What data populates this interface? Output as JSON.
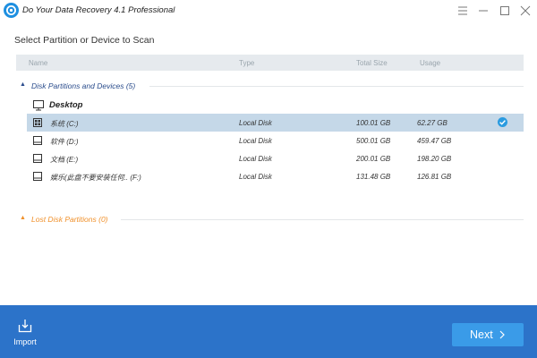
{
  "window": {
    "title": "Do Your Data Recovery 4.1 Professional",
    "controls": [
      "menu-icon",
      "minimize-icon",
      "maximize-icon",
      "close-icon"
    ]
  },
  "heading": "Select Partition or Device to Scan",
  "columns": {
    "name": "Name",
    "type": "Type",
    "total_size": "Total Size",
    "usage": "Usage"
  },
  "groups": {
    "disk": {
      "label": "Disk Partitions and Devices (5)",
      "color": "#2a4c8c",
      "expanded": true
    },
    "lost": {
      "label": "Lost Disk Partitions (0)",
      "color": "#f0902a",
      "expanded": true
    }
  },
  "desktop": {
    "label": "Desktop",
    "icon": "monitor-icon"
  },
  "partitions": [
    {
      "name": "系统 (C:)",
      "type": "Local Disk",
      "total": "100.01 GB",
      "usage": "62.27 GB",
      "selected": true,
      "icon": "system-drive-icon"
    },
    {
      "name": "软件 (D:)",
      "type": "Local Disk",
      "total": "500.01 GB",
      "usage": "459.47 GB",
      "selected": false,
      "icon": "drive-icon"
    },
    {
      "name": "文档 (E:)",
      "type": "Local Disk",
      "total": "200.01 GB",
      "usage": "198.20 GB",
      "selected": false,
      "icon": "drive-icon"
    },
    {
      "name": "娱乐(此盘不要安装任何.. (F:)",
      "type": "Local Disk",
      "total": "131.48 GB",
      "usage": "126.81 GB",
      "selected": false,
      "icon": "drive-icon"
    }
  ],
  "footer": {
    "import_label": "Import",
    "next_label": "Next",
    "color": "#2c73c9",
    "accent": "#3a9be8"
  }
}
